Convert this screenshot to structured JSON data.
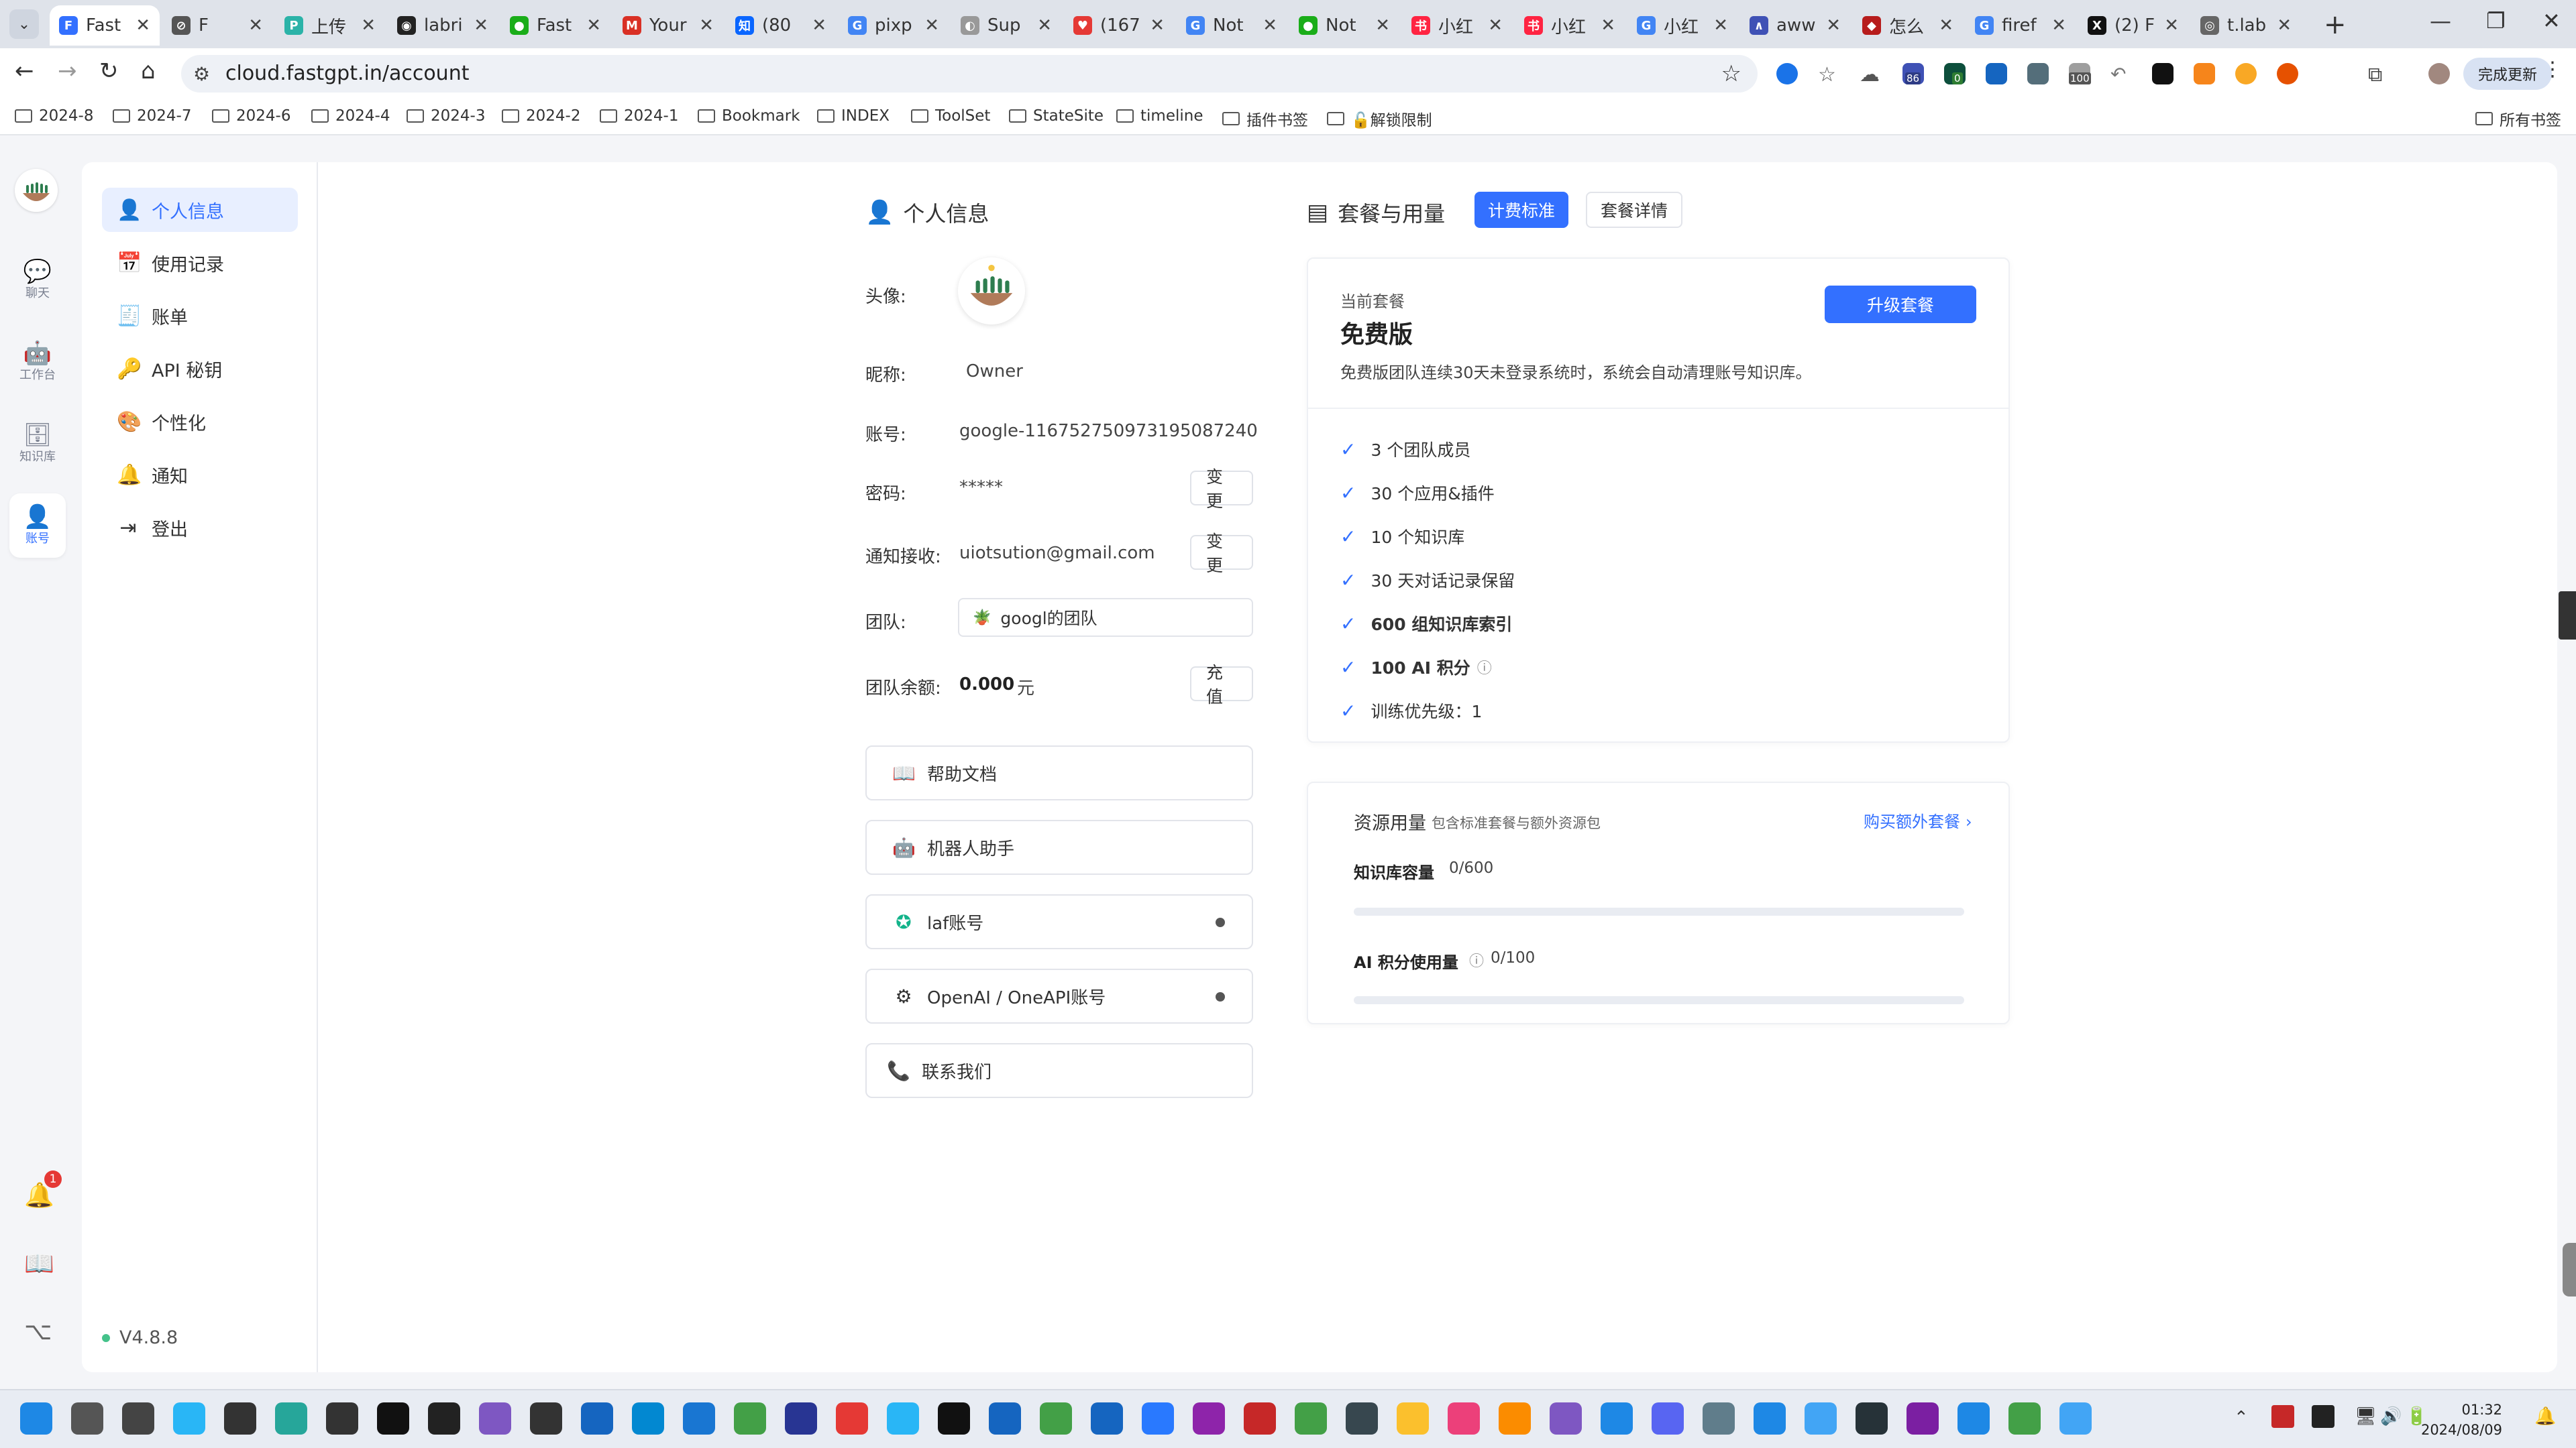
{
  "browser": {
    "tabs": [
      {
        "title": "Fast",
        "active": true,
        "fav": "F",
        "color": "#3370ff"
      },
      {
        "title": "F",
        "fav": "⊘",
        "color": "#555"
      },
      {
        "title": "上传",
        "fav": "P",
        "color": "#2bb3a8"
      },
      {
        "title": "labri",
        "fav": "◉",
        "color": "#222"
      },
      {
        "title": "Fast",
        "fav": "●",
        "color": "#1aad19"
      },
      {
        "title": "Your",
        "fav": "M",
        "color": "#d93025"
      },
      {
        "title": "(80",
        "fav": "知",
        "color": "#0a66ff"
      },
      {
        "title": "pixp",
        "fav": "G",
        "color": "#4285f4"
      },
      {
        "title": "Sup",
        "fav": "◐",
        "color": "#999"
      },
      {
        "title": "(167",
        "fav": "♥",
        "color": "#e53935"
      },
      {
        "title": "Not",
        "fav": "G",
        "color": "#4285f4"
      },
      {
        "title": "Not",
        "fav": "●",
        "color": "#1aad19"
      },
      {
        "title": "小红",
        "fav": "书",
        "color": "#ff2442"
      },
      {
        "title": "小红",
        "fav": "书",
        "color": "#ff2442"
      },
      {
        "title": "小红",
        "fav": "G",
        "color": "#4285f4"
      },
      {
        "title": "aww",
        "fav": "∧",
        "color": "#3f51b5"
      },
      {
        "title": "怎么",
        "fav": "◆",
        "color": "#b71c1c"
      },
      {
        "title": "firef",
        "fav": "G",
        "color": "#4285f4"
      },
      {
        "title": "(2) F",
        "fav": "X",
        "color": "#111"
      },
      {
        "title": "t.lab",
        "fav": "◎",
        "color": "#666"
      }
    ],
    "url": "cloud.fastgpt.in/account",
    "update_label": "完成更新",
    "bookmarks": [
      "2024-8",
      "2024-7",
      "2024-6",
      "2024-4",
      "2024-3",
      "2024-2",
      "2024-1",
      "Bookmark",
      "INDEX",
      "ToolSet",
      "StateSite",
      "timeline",
      "插件书签",
      "🔓解锁限制"
    ],
    "all_bookmarks": "所有书签",
    "ext_badges": {
      "a": "86",
      "b": "0",
      "c": "100"
    }
  },
  "rail": {
    "chat": "聊天",
    "workbench": "工作台",
    "kb": "知识库",
    "account": "账号",
    "notif_count": "1"
  },
  "menu": {
    "items": [
      "个人信息",
      "使用记录",
      "账单",
      "API 秘钥",
      "个性化",
      "通知",
      "登出"
    ],
    "version": "V4.8.8"
  },
  "profile": {
    "title": "个人信息",
    "avatar_label": "头像:",
    "nickname_label": "昵称:",
    "nickname": "Owner",
    "account_label": "账号:",
    "account": "google-116752750973195087240",
    "password_label": "密码:",
    "password": "*****",
    "change": "变更",
    "notify_label": "通知接收:",
    "notify_email": "uiotsution@gmail.com",
    "team_label": "团队:",
    "team": "googl的团队",
    "balance_label": "团队余额:",
    "balance": "0.000",
    "balance_unit": "元",
    "recharge": "充值"
  },
  "links": [
    "帮助文档",
    "机器人助手",
    "laf账号",
    "OpenAI / OneAPI账号",
    "联系我们"
  ],
  "plan": {
    "title": "套餐与用量",
    "billing_btn": "计费标准",
    "details_btn": "套餐详情",
    "current_label": "当前套餐",
    "current_name": "免费版",
    "upgrade": "升级套餐",
    "notice": "免费版团队连续30天未登录系统时，系统会自动清理账号知识库。",
    "features": [
      "3 个团队成员",
      "30 个应用&插件",
      "10 个知识库",
      "30 天对话记录保留",
      "600 组知识库索引",
      "100 AI 积分",
      "训练优先级：1"
    ],
    "usage_title": "资源用量",
    "usage_sub": "包含标准套餐与额外资源包",
    "buy_extra": "购买额外套餐",
    "kb_capacity_label": "知识库容量",
    "kb_capacity_value": "0/600",
    "kb_capacity_fraction": 0,
    "ai_usage_label": "AI 积分使用量",
    "ai_usage_value": "0/100",
    "ai_usage_fraction": 0
  },
  "taskbar": {
    "time": "01:32",
    "date": "2024/08/09"
  },
  "colors": {
    "accent": "#3370ff",
    "ok": "#44c28a"
  }
}
